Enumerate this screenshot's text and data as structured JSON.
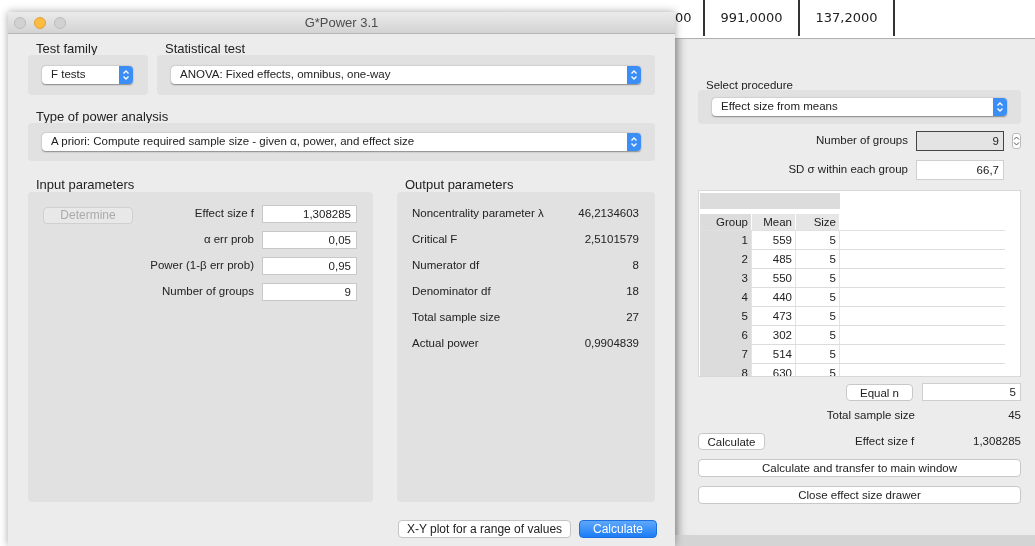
{
  "window": {
    "title": "G*Power 3.1"
  },
  "test_family": {
    "label": "Test family",
    "value": "F tests"
  },
  "statistical_test": {
    "label": "Statistical test",
    "value": "ANOVA: Fixed effects, omnibus, one-way"
  },
  "type_of_power_analysis": {
    "label": "Type of power analysis",
    "value": "A priori: Compute required sample size - given α, power, and effect size"
  },
  "input_parameters": {
    "title": "Input parameters",
    "determine_button": {
      "label": "Determine",
      "disabled": true
    },
    "fields": [
      {
        "label": "Effect size f",
        "value": "1,308285"
      },
      {
        "label": "α err prob",
        "value": "0,05"
      },
      {
        "label": "Power (1-β err prob)",
        "value": "0,95"
      },
      {
        "label": "Number of groups",
        "value": "9"
      }
    ]
  },
  "output_parameters": {
    "title": "Output parameters",
    "rows": [
      {
        "label": "Noncentrality parameter λ",
        "value": "46,2134603"
      },
      {
        "label": "Critical F",
        "value": "2,5101579"
      },
      {
        "label": "Numerator df",
        "value": "8"
      },
      {
        "label": "Denominator df",
        "value": "18"
      },
      {
        "label": "Total sample size",
        "value": "27"
      },
      {
        "label": "Actual power",
        "value": "0,9904839"
      }
    ]
  },
  "buttons": [
    {
      "label": "X-Y plot for a range of values",
      "kind": "plain"
    },
    {
      "label": "Calculate",
      "kind": "primary"
    }
  ],
  "background_sheet": {
    "cells": [
      "00",
      "991,0000",
      "137,2000"
    ]
  },
  "effect_size_drawer": {
    "select_procedure": {
      "label": "Select procedure",
      "value": "Effect size from means"
    },
    "number_of_groups": {
      "label": "Number of groups",
      "value": "9"
    },
    "sd_within": {
      "label": "SD σ within each group",
      "value": "66,7"
    },
    "table": {
      "columns": [
        "Group",
        "Mean",
        "Size"
      ],
      "rows": [
        [
          "1",
          "559",
          "5"
        ],
        [
          "2",
          "485",
          "5"
        ],
        [
          "3",
          "550",
          "5"
        ],
        [
          "4",
          "440",
          "5"
        ],
        [
          "5",
          "473",
          "5"
        ],
        [
          "6",
          "302",
          "5"
        ],
        [
          "7",
          "514",
          "5"
        ],
        [
          "8",
          "630",
          "5"
        ]
      ]
    },
    "equal_n": {
      "button": "Equal n",
      "value": "5"
    },
    "total_sample_size": {
      "label": "Total sample size",
      "value": "45"
    },
    "calculate_button": "Calculate",
    "effect_size": {
      "label": "Effect size f",
      "value": "1,308285"
    },
    "buttons": [
      "Calculate and transfer to main window",
      "Close effect size drawer"
    ]
  }
}
